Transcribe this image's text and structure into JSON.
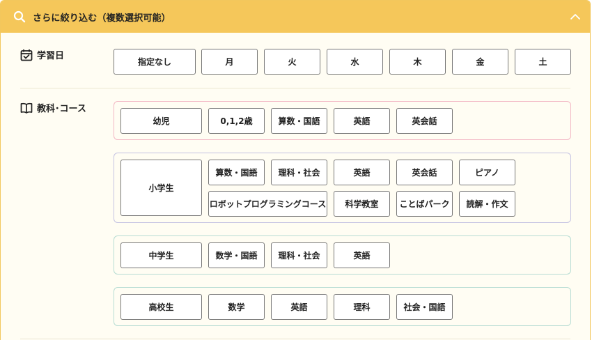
{
  "header": {
    "title": "さらに絞り込む（複数選択可能）",
    "search_icon": "search-icon",
    "collapse_icon": "chevron-up-icon"
  },
  "day": {
    "label": "学習日",
    "icon": "calendar-check-icon",
    "options": [
      "指定なし",
      "月",
      "火",
      "水",
      "木",
      "金",
      "土"
    ]
  },
  "subject": {
    "label": "教科･コース",
    "icon": "book-open-icon",
    "groups": {
      "infant": {
        "border": "#f3b7c4",
        "items": [
          "幼児",
          "0,1,2歳",
          "算数・国語",
          "英語",
          "英会話"
        ]
      },
      "elementary": {
        "border": "#c4c2e2",
        "title": "小学生",
        "items": [
          "算数・国語",
          "理科・社会",
          "英語",
          "英会話",
          "ピアノ",
          "ロボットプログラミングコース",
          "科学教室",
          "ことばパーク",
          "読解・作文"
        ]
      },
      "junior": {
        "border": "#b6dcd3",
        "items": [
          "中学生",
          "数学・国語",
          "理科・社会",
          "英語"
        ]
      },
      "high": {
        "border": "#b6dcd3",
        "items": [
          "高校生",
          "数学",
          "英語",
          "理科",
          "社会・国語"
        ]
      }
    }
  },
  "colors": {
    "header_bg": "#f5c75a",
    "panel_bg": "#fffdf3"
  }
}
